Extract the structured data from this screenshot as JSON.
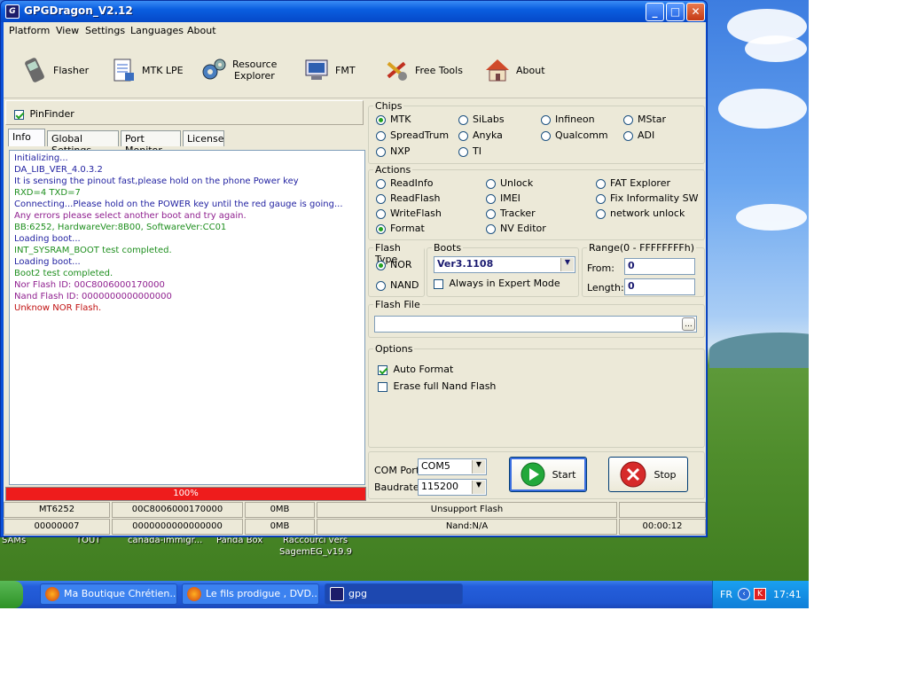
{
  "window": {
    "title": "GPGDragon_V2.12"
  },
  "menu": [
    "Platform",
    "View",
    "Settings",
    "Languages",
    "About"
  ],
  "toolbar": [
    {
      "label": "Flasher",
      "icon": "phone-icon"
    },
    {
      "label": "MTK LPE",
      "icon": "document-icon"
    },
    {
      "label_line1": "Resource",
      "label_line2": "Explorer",
      "icon": "gears-icon"
    },
    {
      "label": "FMT",
      "icon": "computer-icon"
    },
    {
      "label": "Free Tools",
      "icon": "tools-icon"
    },
    {
      "label": "About",
      "icon": "home-icon"
    }
  ],
  "pinfinder": {
    "label": "PinFinder",
    "checked": true
  },
  "tabs": [
    "Info",
    "Global Settings",
    "Port Monitor",
    "License"
  ],
  "log": [
    {
      "text": "Initializing...",
      "color": "#1f1fa0"
    },
    {
      "text": "DA_LIB_VER_4.0.3.2",
      "color": "#1f1fa0"
    },
    {
      "text": "It is sensing the pinout fast,please hold on the phone Power key",
      "color": "#1f1fa0"
    },
    {
      "text": "RXD=4  TXD=7",
      "color": "#1f8f1f"
    },
    {
      "text": "Connecting...Please hold on the POWER key until the red gauge is going...",
      "color": "#1f1fa0"
    },
    {
      "text": "Any errors please select another boot and try again.",
      "color": "#8f1f8f"
    },
    {
      "text": "BB:6252,    HardwareVer:8B00,    SoftwareVer:CC01",
      "color": "#1f8f1f"
    },
    {
      "text": "Loading boot...",
      "color": "#1f1fa0"
    },
    {
      "text": "INT_SYSRAM_BOOT test completed.",
      "color": "#1f8f1f"
    },
    {
      "text": "Loading boot...",
      "color": "#1f1fa0"
    },
    {
      "text": "Boot2 test completed.",
      "color": "#1f8f1f"
    },
    {
      "text": "Nor Flash ID: 00C8006000170000",
      "color": "#8f1f8f"
    },
    {
      "text": "Nand Flash ID: 0000000000000000",
      "color": "#8f1f8f"
    },
    {
      "text": "Unknow NOR Flash.",
      "color": "#c01010"
    }
  ],
  "progress": {
    "label": "100%",
    "value": 100
  },
  "chips": {
    "label": "Chips",
    "options": [
      "MTK",
      "SiLabs",
      "Infineon",
      "MStar",
      "SpreadTrum",
      "Anyka",
      "Qualcomm",
      "ADI",
      "NXP",
      "TI"
    ],
    "selected": "MTK"
  },
  "actions": {
    "label": "Actions",
    "options": [
      "ReadInfo",
      "Unlock",
      "FAT Explorer",
      "ReadFlash",
      "IMEI",
      "Fix Informality SW",
      "WriteFlash",
      "Tracker",
      "network unlock",
      "Format",
      "NV Editor"
    ],
    "selected": "Format"
  },
  "flash_type": {
    "label": "Flash Type",
    "options": [
      "NOR",
      "NAND"
    ],
    "selected": "NOR"
  },
  "boots": {
    "label": "Boots",
    "value": "Ver3.1108",
    "expert_label": "Always in Expert Mode",
    "expert_checked": false
  },
  "range": {
    "label": "Range(0 - FFFFFFFFh)",
    "from_label": "From:",
    "from_value": "0",
    "length_label": "Length:",
    "length_value": "0"
  },
  "flash_file": {
    "label": "Flash File",
    "value": "",
    "browse": "..."
  },
  "options": {
    "label": "Options",
    "auto_format": "Auto Format",
    "auto_format_checked": true,
    "erase_nand": "Erase full Nand Flash",
    "erase_nand_checked": false
  },
  "com": {
    "port_label": "COM Port",
    "port_value": "COM5",
    "baud_label": "Baudrate",
    "baud_value": "115200"
  },
  "buttons": {
    "start": "Start",
    "stop": "Stop"
  },
  "status_row1": [
    "MT6252",
    "00C8006000170000",
    "0MB",
    "Unsupport Flash",
    ""
  ],
  "status_row2": [
    "00000007",
    "0000000000000000",
    "0MB",
    "Nand:N/A",
    "00:00:12"
  ],
  "desktop_icons": [
    "SAMs",
    "TOUT",
    "canada-immigr...",
    "Panda Box",
    "Raccourci vers",
    "SagemEG_v19.9"
  ],
  "taskbar": {
    "tasks": [
      "Ma Boutique Chrétien...",
      "Le fils prodigue , DVD...",
      "gpg"
    ],
    "lang": "FR",
    "time": "17:41"
  }
}
